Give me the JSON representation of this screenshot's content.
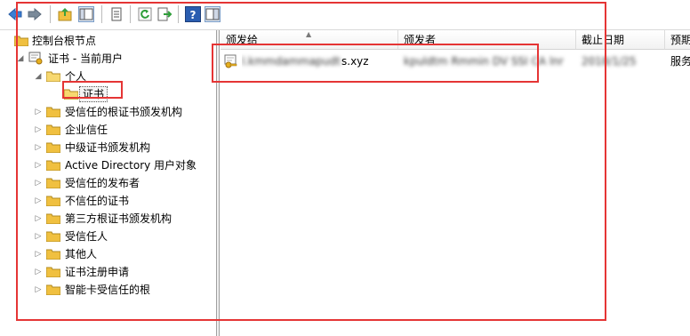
{
  "toolbar": {
    "buttons": [
      {
        "name": "back-icon"
      },
      {
        "name": "forward-icon"
      },
      {
        "name": "up-folder-icon"
      },
      {
        "name": "show-hide-console-tree-icon"
      },
      {
        "name": "properties-icon"
      },
      {
        "name": "refresh-icon"
      },
      {
        "name": "export-list-icon"
      },
      {
        "name": "help-icon"
      },
      {
        "name": "show-hide-action-pane-icon"
      }
    ]
  },
  "tree": {
    "root": "控制台根节点",
    "store": "证书 - 当前用户",
    "personal": "个人",
    "personal_cert": "证书",
    "items": [
      "受信任的根证书颁发机构",
      "企业信任",
      "中级证书颁发机构",
      "Active Directory 用户对象",
      "受信任的发布者",
      "不信任的证书",
      "第三方根证书颁发机构",
      "受信任人",
      "其他人",
      "证书注册申请",
      "智能卡受信任的根"
    ]
  },
  "list": {
    "columns": [
      "颁发给",
      "颁发者",
      "截止日期",
      "预期"
    ],
    "rows": [
      {
        "issued_to": "l.kmmdammapudtriis.xyz",
        "issued_by": "kpuldtm Rmmin DV SSI CA   lnr",
        "expires": "2018/1/25",
        "purpose": "服务"
      }
    ]
  },
  "colors": {
    "highlight_red": "#e53535",
    "folder_yellow": "#f0c040"
  }
}
